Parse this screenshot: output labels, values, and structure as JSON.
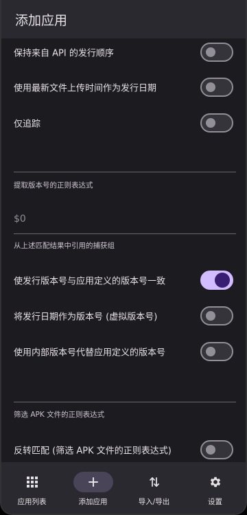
{
  "appbar": {
    "title": "添加应用"
  },
  "settings": {
    "keep_api_order": {
      "label": "保持来自 API 的发行顺序",
      "enabled": false
    },
    "use_latest_upload": {
      "label": "使用最新文件上传时间作为发行日期",
      "enabled": false
    },
    "track_only": {
      "label": "仅追踪",
      "enabled": false
    },
    "version_regex": {
      "label": "提取版本号的正则表达式",
      "value": "$0",
      "helper": "从上述匹配结果中引用的捕获组"
    },
    "match_version": {
      "label": "使发行版本号与应用定义的版本号一致",
      "enabled": true
    },
    "date_as_version": {
      "label": "将发行日期作为版本号 (虚拟版本号)",
      "enabled": false
    },
    "internal_version": {
      "label": "使用内部版本号代替应用定义的版本号",
      "enabled": false
    },
    "apk_filter_regex": {
      "label": "筛选 APK 文件的正则表达式"
    },
    "invert_filter": {
      "label": "反转匹配 (筛选 APK 文件的正则表达式)",
      "enabled": false
    }
  },
  "navbar": {
    "items": [
      {
        "label": "应用列表",
        "icon": "apps-grid-icon"
      },
      {
        "label": "添加应用",
        "icon": "add-icon",
        "active": true
      },
      {
        "label": "导入/导出",
        "icon": "import-export-icon"
      },
      {
        "label": "设置",
        "icon": "gear-icon"
      }
    ]
  },
  "colors": {
    "surface": "#1c1b1f",
    "bar": "#2b2930",
    "accent": "#d0bcff",
    "accent_dark": "#381e72",
    "nav_active": "#4a4458"
  }
}
